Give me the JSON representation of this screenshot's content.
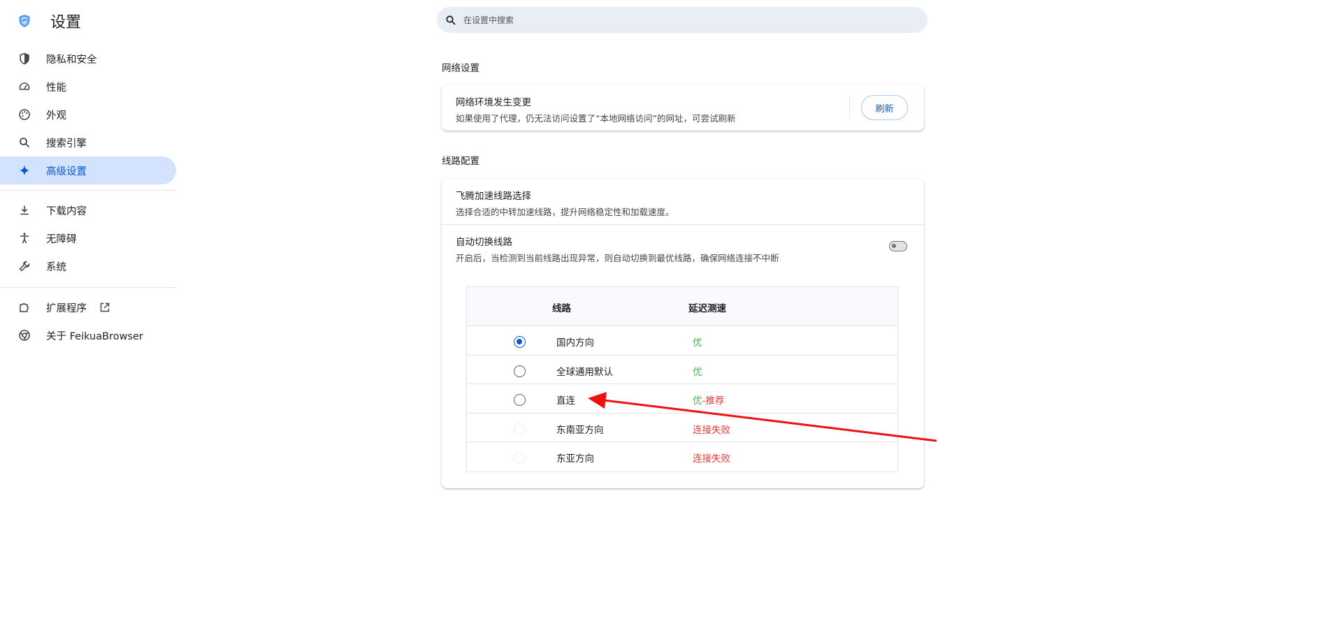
{
  "app": {
    "title": "设置"
  },
  "colors": {
    "accent": "#0b57d0",
    "active_bg": "#d3e3fd",
    "good": "#4caf50",
    "bad": "#e53935",
    "arrow": "#ee1111"
  },
  "sidebar": {
    "items": [
      {
        "label": "隐私和安全",
        "icon": "shield-icon"
      },
      {
        "label": "性能",
        "icon": "speedometer-icon"
      },
      {
        "label": "外观",
        "icon": "palette-icon"
      },
      {
        "label": "搜索引擎",
        "icon": "search-icon"
      },
      {
        "label": "高级设置",
        "icon": "sparkle-icon",
        "active": true
      },
      {
        "label": "下载内容",
        "icon": "download-icon"
      },
      {
        "label": "无障碍",
        "icon": "accessibility-icon"
      },
      {
        "label": "系统",
        "icon": "wrench-icon"
      },
      {
        "label": "扩展程序",
        "icon": "puzzle-icon"
      },
      {
        "label": "关于 FeikuaBrowser",
        "icon": "browser-logo-icon"
      }
    ]
  },
  "search": {
    "placeholder": "在设置中搜索"
  },
  "network": {
    "section_title": "网络设置",
    "title": "网络环境发生变更",
    "subtitle": "如果使用了代理，仍无法访问设置了“本地网络访问”的网址，可尝试刷新",
    "refresh_label": "刷新"
  },
  "routes": {
    "section_title": "线路配置",
    "select_title": "飞腾加速线路选择",
    "select_subtitle": "选择合适的中转加速线路，提升网络稳定性和加载速度。",
    "auto_title": "自动切换线路",
    "auto_subtitle": "开启后，当检测到当前线路出现异常，则自动切换到最优线路，确保网络连接不中断",
    "auto_enabled": false,
    "table": {
      "col_route": "线路",
      "col_latency": "延迟测速",
      "rows": [
        {
          "name": "国内方向",
          "latency": "优",
          "status": "good",
          "checked": true
        },
        {
          "name": "全球通用默认",
          "latency": "优",
          "status": "good",
          "checked": false
        },
        {
          "name": "直连",
          "latency": "优",
          "latency_extra": "-推荐",
          "status": "good",
          "checked": false
        },
        {
          "name": "东南亚方向",
          "latency": "连接失败",
          "status": "bad",
          "checked": false,
          "disabled": true
        },
        {
          "name": "东亚方向",
          "latency": "连接失败",
          "status": "bad",
          "checked": false,
          "disabled": true
        }
      ]
    }
  }
}
